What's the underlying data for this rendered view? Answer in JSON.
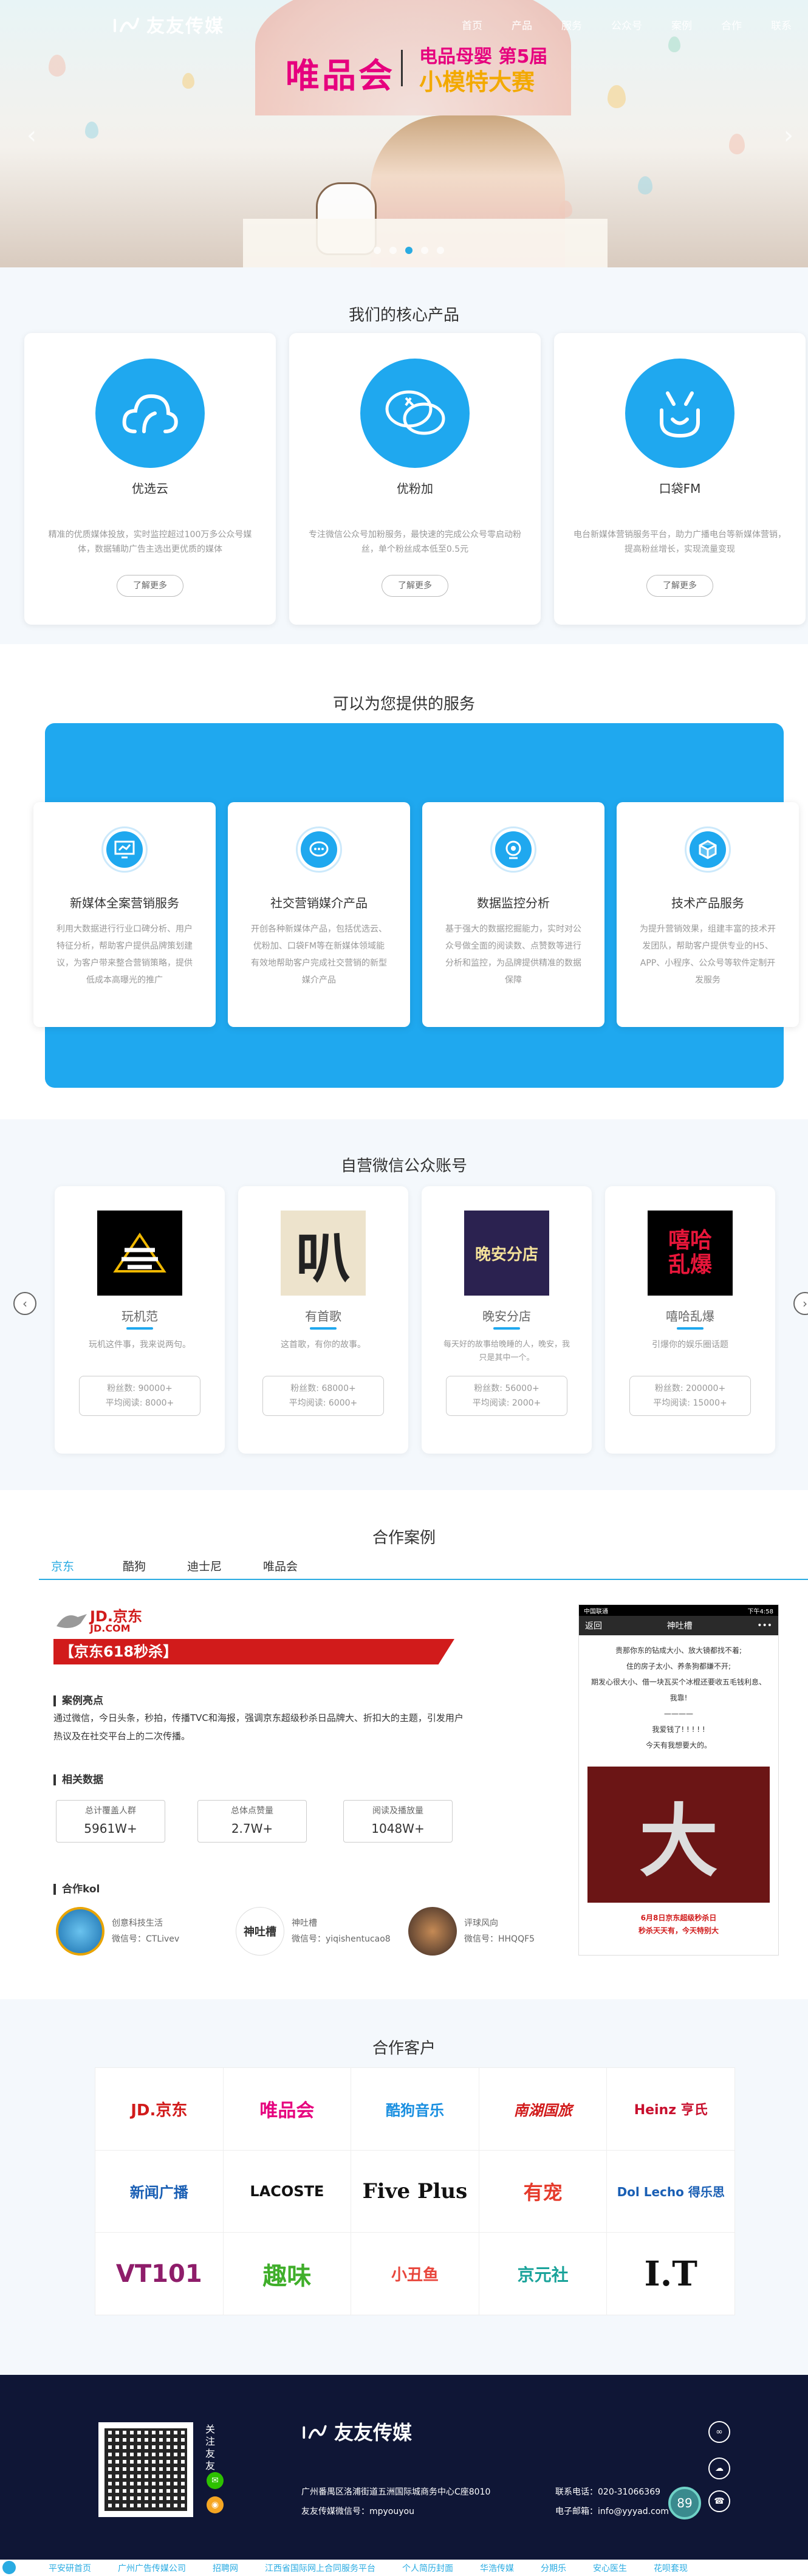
{
  "header": {
    "logo_text": "友友传媒",
    "nav": [
      "首页",
      "产品",
      "服务",
      "公众号",
      "案例",
      "合作",
      "联系"
    ]
  },
  "banner": {
    "title": "唯品会",
    "subtitle1": "电品母婴 第5届",
    "subtitle2": "小模特大赛",
    "prev": "‹",
    "next": "›"
  },
  "products": {
    "title": "我们的核心产品",
    "items": [
      {
        "name": "优选云",
        "desc": "精准的优质媒体投放，实时监控超过100万多公众号媒体，数据辅助广告主选出更优质的媒体",
        "btn": "了解更多",
        "icon": "cloud-icon"
      },
      {
        "name": "优粉加",
        "desc": "专注微信公众号加粉服务，最快速的完成公众号零启动粉丝，单个粉丝成本低至0.5元",
        "btn": "了解更多",
        "icon": "chat-icon"
      },
      {
        "name": "口袋FM",
        "desc": "电台新媒体营销服务平台，助力广播电台等新媒体营销，提高粉丝增长，实现流量变现",
        "btn": "了解更多",
        "icon": "fm-icon"
      }
    ]
  },
  "services": {
    "title": "可以为您提供的服务",
    "items": [
      {
        "name": "新媒体全案营销服务",
        "desc": "利用大数据进行行业口碑分析、用户特征分析，帮助客户提供品牌策划建议，为客户带来整合营销策略，提供低成本高曝光的推广",
        "icon": "monitor-icon"
      },
      {
        "name": "社交营销媒介产品",
        "desc": "开创各种新媒体产品，包括优选云、优粉加、口袋FM等在新媒体领域能有效地帮助客户完成社交营销的新型媒介产品",
        "icon": "message-icon"
      },
      {
        "name": "数据监控分析",
        "desc": "基于强大的数据挖掘能力，实时对公众号做全面的阅读数、点赞数等进行分析和监控，为品牌提供精准的数据保障",
        "icon": "camera-icon"
      },
      {
        "name": "技术产品服务",
        "desc": "为提升营销效果，组建丰富的技术开发团队，帮助客户提供专业的H5、APP、小程序、公众号等软件定制开发服务",
        "icon": "cube-icon"
      }
    ]
  },
  "accounts": {
    "title": "自营微信公众账号",
    "items": [
      {
        "name": "玩机范",
        "desc": "玩机这件事，我来说两句。",
        "fans": "粉丝数: 90000+",
        "reads": "平均阅读: 8000+"
      },
      {
        "name": "有首歌",
        "desc": "这首歌，有你的故事。",
        "fans": "粉丝数: 68000+",
        "reads": "平均阅读: 6000+"
      },
      {
        "name": "晚安分店",
        "desc": "每天好的故事给晚睡的人，晚安，我只是其中一个。",
        "fans": "粉丝数: 56000+",
        "reads": "平均阅读: 2000+"
      },
      {
        "name": "嘻哈乱爆",
        "desc": "引爆你的娱乐圈话题",
        "fans": "粉丝数: 200000+",
        "reads": "平均阅读: 15000+"
      }
    ]
  },
  "cases": {
    "title": "合作案例",
    "tabs": [
      "京东",
      "酷狗",
      "迪士尼",
      "唯品会"
    ],
    "jd_logo": "JD.京东",
    "jd_sub": "JD.COM",
    "banner": "【京东618秒杀】",
    "highlight_title": "案例亮点",
    "highlight": "通过微信，今日头条，秒拍，传播TVC和海报，强调京东超级秒杀日品牌大、折扣大的主题，引发用户热议及在社交平台上的二次传播。",
    "data_title": "相关数据",
    "stats": [
      {
        "t": "总计覆盖人群",
        "v": "5961W+"
      },
      {
        "t": "总体点赞量",
        "v": "2.7W+"
      },
      {
        "t": "阅读及播放量",
        "v": "1048W+"
      }
    ],
    "kol_title": "合作kol",
    "kols": [
      {
        "name": "创意科技生活",
        "id": "微信号：CTLivev"
      },
      {
        "name": "神吐槽",
        "id": "微信号：yiqishentucao8"
      },
      {
        "name": "评球风向",
        "id": "微信号：HHQQF5"
      }
    ],
    "phone": {
      "status_left": "中国联通",
      "status_time": "下午4:58",
      "back": "返回",
      "title": "神吐槽",
      "more": "•••",
      "lines": [
        "贵那你东的钻成大小、放大镜都找不着;",
        "住的房子太小、养条狗都嫌不开;",
        "期发心很大小、借一块瓦买个冰棍还要收五毛钱利息、我靠!",
        "————",
        "我爱钱了! ! ! ! !",
        "今天有我想要大的。"
      ],
      "big": "大",
      "cap1": "6月8日京东超级秒杀日",
      "cap2": "秒杀天天有，今天特别大"
    }
  },
  "clients": {
    "title": "合作客户",
    "logos": [
      "JD.京东",
      "唯品会",
      "酷狗音乐",
      "南湖国旅",
      "Heinz 亨氏",
      "新闻广播",
      "LACOSTE",
      "Five Plus",
      "有宠",
      "Dol Lecho 得乐思",
      "VT101",
      "趣味",
      "小丑鱼",
      "京元社",
      "I.T"
    ]
  },
  "footer": {
    "qr_text": "关注友友",
    "logo": "友友传媒",
    "address": "广州番禺区洛浦街道五洲国际城商务中心C座8010",
    "phone": "联系电话：020-31066369",
    "wechat": "友友传媒微信号：mpyouyou",
    "email": "电子邮箱：info@yyyad.com",
    "score": "89"
  },
  "bottom_links": [
    "平安研首页",
    "广州广告传媒公司",
    "招聘网",
    "江西省国际网上合同服务平台",
    "个人简历封面",
    "华浩传媒",
    "分期乐",
    "安心医生",
    "花呗套现"
  ]
}
